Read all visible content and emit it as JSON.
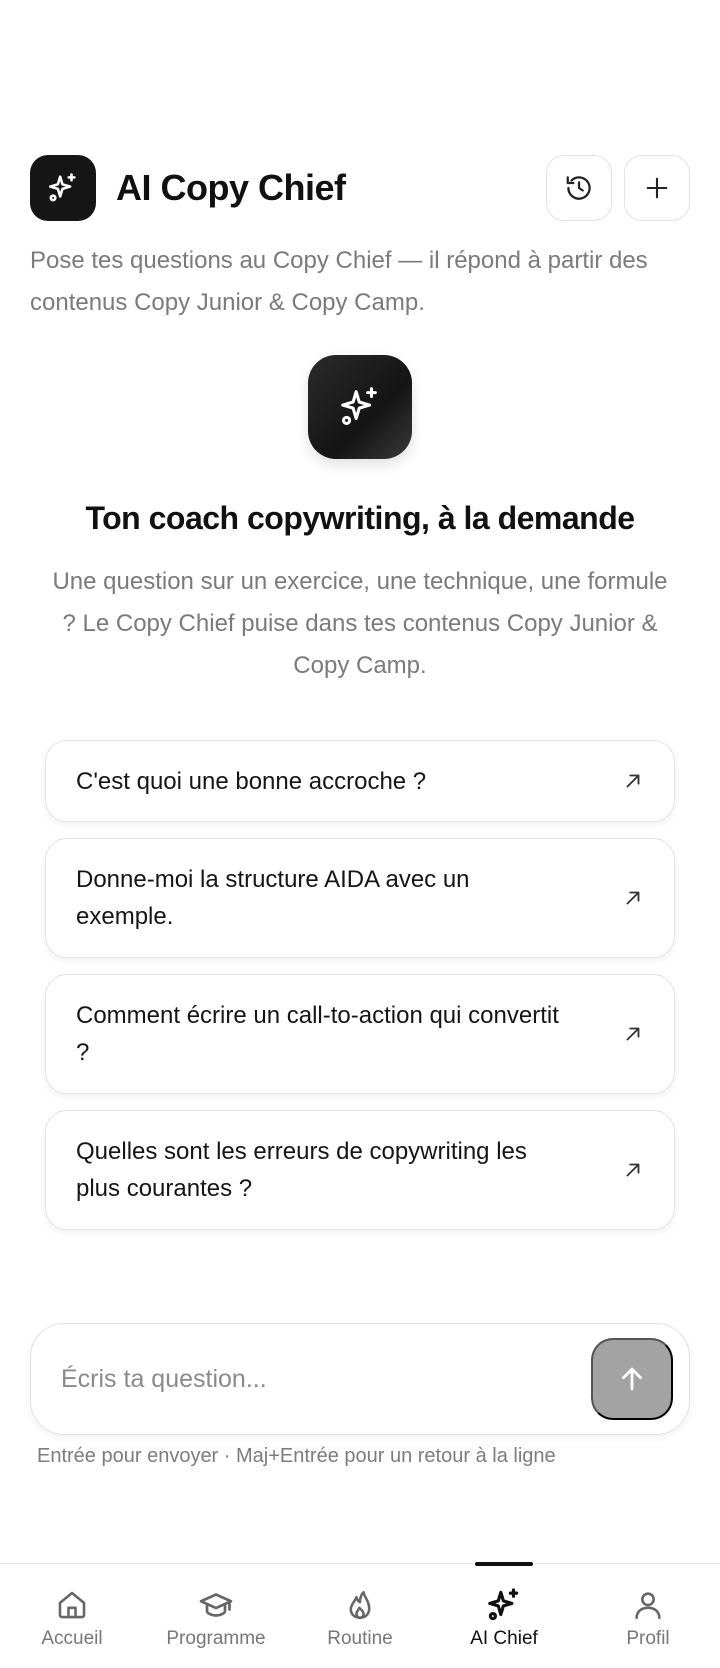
{
  "header": {
    "title": "AI Copy Chief",
    "subtitle": "Pose tes questions au Copy Chief — il répond à partir des contenus Copy Junior & Copy Camp.",
    "history_icon": "history-icon",
    "new_chat_icon": "plus-icon"
  },
  "hero": {
    "icon": "sparkles-icon",
    "title": "Ton coach copywriting, à la demande",
    "description": "Une question sur un exercice, une technique, une formule ? Le Copy Chief puise dans tes contenus Copy Junior & Copy Camp."
  },
  "suggestions": [
    {
      "text": "C'est quoi une bonne accroche ?"
    },
    {
      "text": "Donne-moi la structure AIDA avec un exemple."
    },
    {
      "text": "Comment écrire un call-to-action qui convertit ?"
    },
    {
      "text": "Quelles sont les erreurs de copywriting les plus courantes ?"
    }
  ],
  "composer": {
    "placeholder": "Écris ta question...",
    "value": "",
    "send_icon": "arrow-up-icon",
    "hint": "Entrée pour envoyer · Maj+Entrée pour un retour à la ligne"
  },
  "nav": {
    "items": [
      {
        "label": "Accueil",
        "icon": "home-icon",
        "active": false
      },
      {
        "label": "Programme",
        "icon": "graduation-cap-icon",
        "active": false
      },
      {
        "label": "Routine",
        "icon": "flame-icon",
        "active": false
      },
      {
        "label": "AI Chief",
        "icon": "sparkles-icon",
        "active": true
      },
      {
        "label": "Profil",
        "icon": "user-icon",
        "active": false
      }
    ]
  },
  "colors": {
    "accent": "#161616",
    "muted_text": "#7a7a7a",
    "send_button_disabled": "#a3a3a3",
    "border": "#e2e2e2"
  }
}
